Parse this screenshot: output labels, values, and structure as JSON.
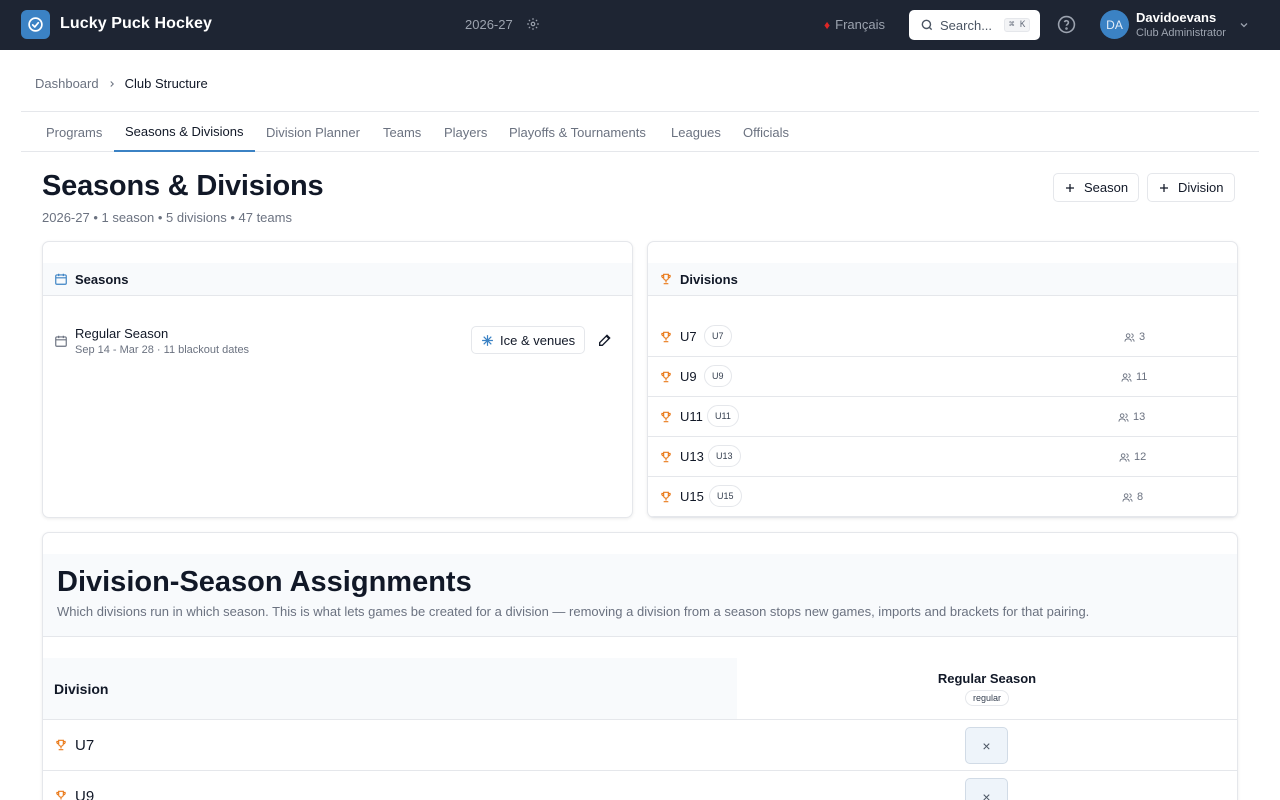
{
  "app": {
    "title": "Lucky Puck Hockey",
    "season_year": "2026-27",
    "language": "Français",
    "search_placeholder": "Search...",
    "search_shortcut": "⌘ K"
  },
  "user": {
    "initials": "DA",
    "name": "Davidoevans",
    "role": "Club Administrator"
  },
  "breadcrumb": {
    "parent": "Dashboard",
    "current": "Club Structure"
  },
  "tabs": [
    {
      "label": "Programs"
    },
    {
      "label": "Seasons & Divisions"
    },
    {
      "label": "Division Planner"
    },
    {
      "label": "Teams"
    },
    {
      "label": "Players"
    },
    {
      "label": "Playoffs & Tournaments"
    },
    {
      "label": "Leagues"
    },
    {
      "label": "Officials"
    }
  ],
  "page": {
    "title": "Seasons & Divisions",
    "subtitle": "2026-27 • 1 season • 5 divisions • 47 teams",
    "add_season_label": "Season",
    "add_division_label": "Division"
  },
  "seasons_card": {
    "title": "Seasons",
    "items": [
      {
        "name": "Regular Season",
        "dates": "Sep 14 - Mar 28 · 11 blackout dates",
        "ice_label": "Ice & venues"
      }
    ]
  },
  "divisions_card": {
    "title": "Divisions",
    "items": [
      {
        "name": "U7",
        "code": "U7",
        "teams": "3"
      },
      {
        "name": "U9",
        "code": "U9",
        "teams": "11"
      },
      {
        "name": "U11",
        "code": "U11",
        "teams": "13"
      },
      {
        "name": "U13",
        "code": "U13",
        "teams": "12"
      },
      {
        "name": "U15",
        "code": "U15",
        "teams": "8"
      }
    ]
  },
  "assignments": {
    "title": "Division-Season Assignments",
    "description": "Which divisions run in which season. This is what lets games be created for a division — removing a division from a season stops new games, imports and brackets for that pairing.",
    "column_division": "Division",
    "season_name": "Regular Season",
    "season_type": "regular",
    "rows": [
      {
        "name": "U7",
        "mark": "×"
      },
      {
        "name": "U9",
        "mark": "×"
      }
    ]
  },
  "colors": {
    "topbar": "#1e2533",
    "accent": "#3b82c4",
    "trophy": "#ea7a1a"
  }
}
